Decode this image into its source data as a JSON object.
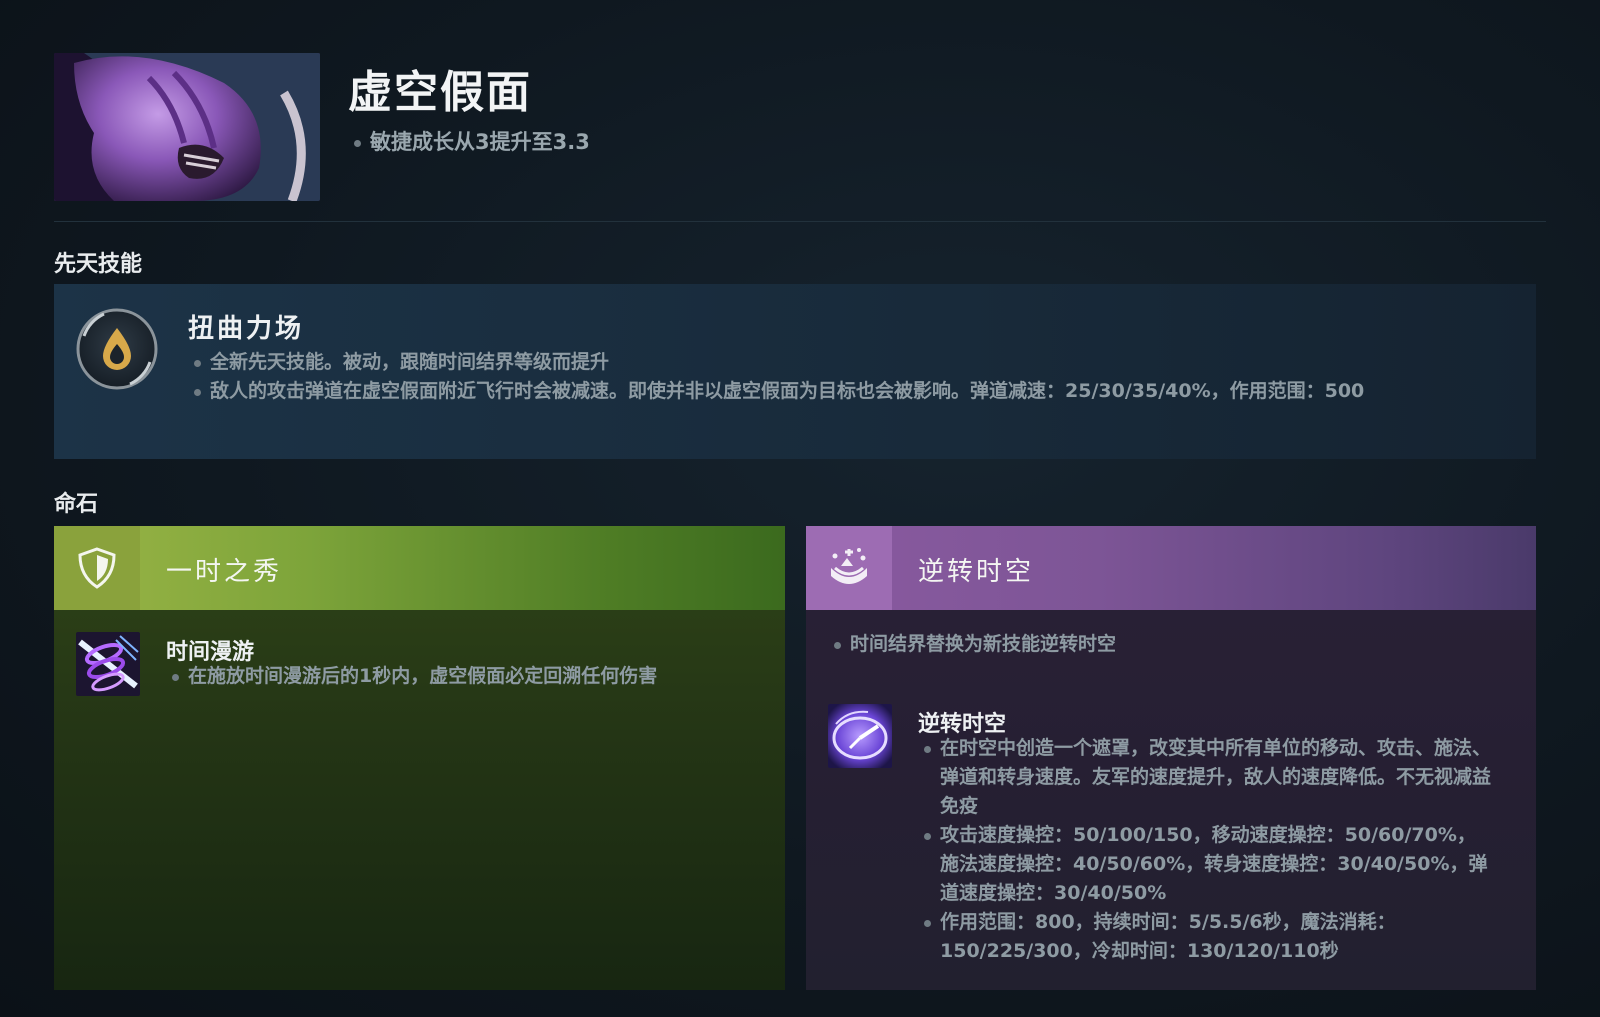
{
  "hero": {
    "name": "虚空假面",
    "notes": [
      "敏捷成长从3提升至3.3"
    ]
  },
  "innate": {
    "section_title": "先天技能",
    "name": "扭曲力场",
    "points": [
      "全新先天技能。被动，跟随时间结界等级而提升",
      "敌人的攻击弹道在虚空假面附近飞行时会被减速。即使并非以虚空假面为目标也会被影响。弹道减速：25/30/35/40%，作用范围：500"
    ]
  },
  "facets": {
    "section_title": "命石",
    "left": {
      "title": "一时之秀",
      "icon": "shield-icon",
      "accent": "#8aa23c",
      "ability": {
        "name": "时间漫游",
        "points": [
          "在施放时间漫游后的1秒内，虚空假面必定回溯任何伤害"
        ]
      }
    },
    "right": {
      "title": "逆转时空",
      "icon": "hourglass-bubble-icon",
      "accent": "#9d6cb3",
      "note": "时间结界替换为新技能逆转时空",
      "ability": {
        "name": "逆转时空",
        "points": [
          "在时空中创造一个遮罩，改变其中所有单位的移动、攻击、施法、弹道和转身速度。友军的速度提升，敌人的速度降低。不无视减益免疫",
          "攻击速度操控：50/100/150，移动速度操控：50/60/70%，施法速度操控：40/50/60%，转身速度操控：30/40/50%，弹道速度操控：30/40/50%",
          "作用范围：800，持续时间：5/5.5/6秒，魔法消耗：150/225/300，冷却时间：130/120/110秒"
        ]
      }
    }
  }
}
